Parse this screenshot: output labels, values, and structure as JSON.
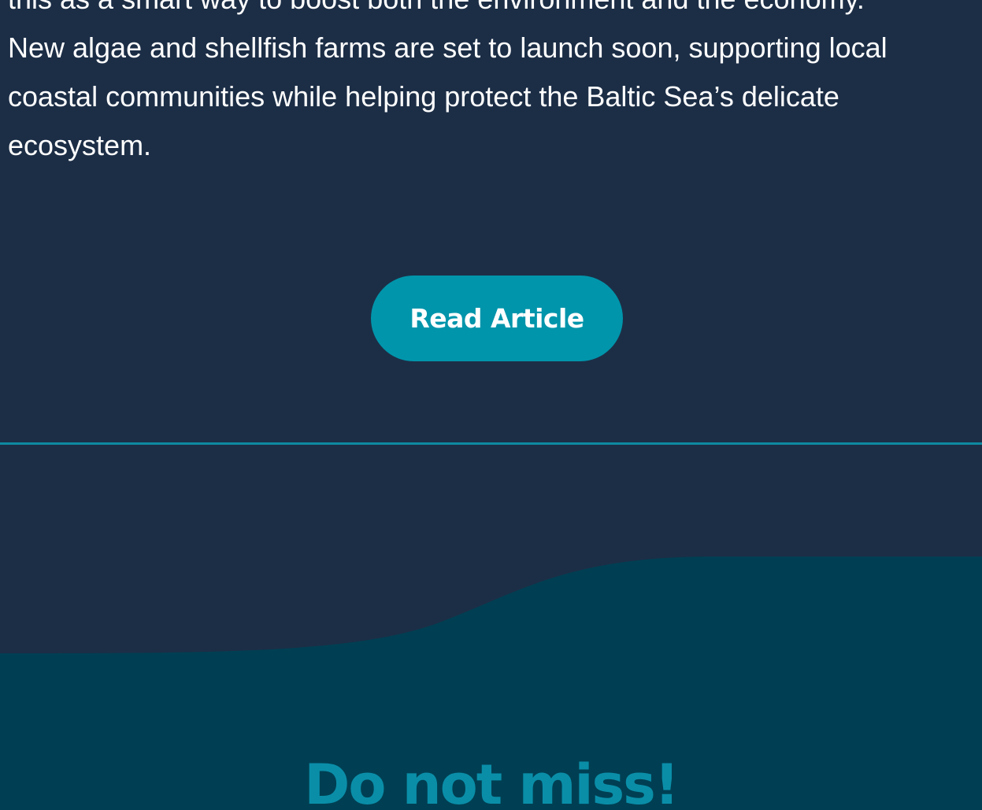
{
  "article": {
    "excerpt_lines": [
      "this as a smart way to boost both the environment and the economy.",
      "New algae and shellfish farms are set to launch soon, supporting local",
      "coastal communities while helping protect the Baltic Sea’s delicate",
      "ecosystem."
    ],
    "read_button_label": "Read Article"
  },
  "section": {
    "heading": "Do not miss!"
  },
  "colors": {
    "background": "#1c2e46",
    "accent": "#0095ab",
    "wave": "#003f53",
    "heading": "#0a8ea8"
  }
}
